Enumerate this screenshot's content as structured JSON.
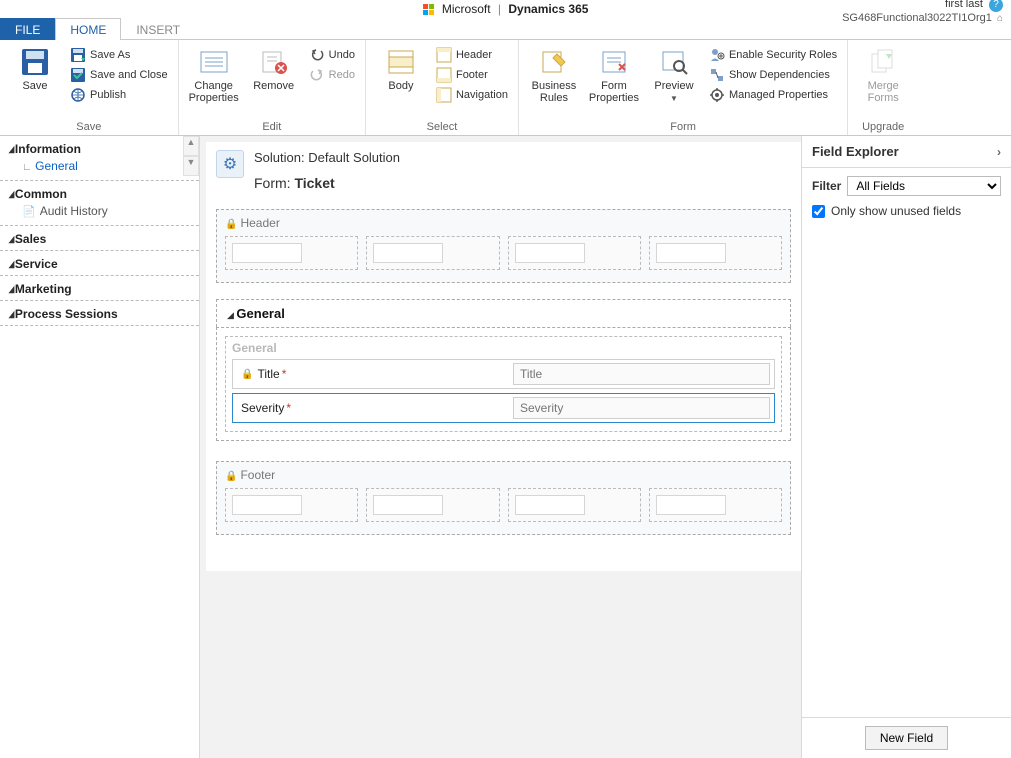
{
  "brand": {
    "company": "Microsoft",
    "product": "Dynamics 365"
  },
  "user": {
    "name": "first last",
    "org": "SG468Functional3022TI1Org1"
  },
  "tabs": {
    "file": "FILE",
    "home": "HOME",
    "insert": "INSERT"
  },
  "ribbon": {
    "save": {
      "big": "Save",
      "saveAs": "Save As",
      "saveClose": "Save and Close",
      "publish": "Publish",
      "group": "Save"
    },
    "edit": {
      "changeProps": "Change\nProperties",
      "remove": "Remove",
      "undo": "Undo",
      "redo": "Redo",
      "group": "Edit"
    },
    "select": {
      "body": "Body",
      "header": "Header",
      "footer": "Footer",
      "navigation": "Navigation",
      "group": "Select"
    },
    "form": {
      "businessRules": "Business\nRules",
      "formProps": "Form\nProperties",
      "preview": "Preview",
      "enableSec": "Enable Security Roles",
      "showDeps": "Show Dependencies",
      "managedProps": "Managed Properties",
      "group": "Form"
    },
    "upgrade": {
      "merge": "Merge\nForms",
      "group": "Upgrade"
    }
  },
  "nav": {
    "information": "Information",
    "general": "General",
    "common": "Common",
    "audit": "Audit History",
    "sales": "Sales",
    "service": "Service",
    "marketing": "Marketing",
    "process": "Process Sessions"
  },
  "canvas": {
    "solutionLabel": "Solution:",
    "solutionName": "Default Solution",
    "formLabel": "Form:",
    "formName": "Ticket",
    "headerSection": "Header",
    "generalTab": "General",
    "generalSection": "General",
    "titleField": {
      "label": "Title",
      "placeholder": "Title"
    },
    "severityField": {
      "label": "Severity",
      "placeholder": "Severity"
    },
    "footerSection": "Footer"
  },
  "explorer": {
    "title": "Field Explorer",
    "filterLabel": "Filter",
    "filterValue": "All Fields",
    "onlyUnused": "Only show unused fields",
    "newField": "New Field"
  }
}
